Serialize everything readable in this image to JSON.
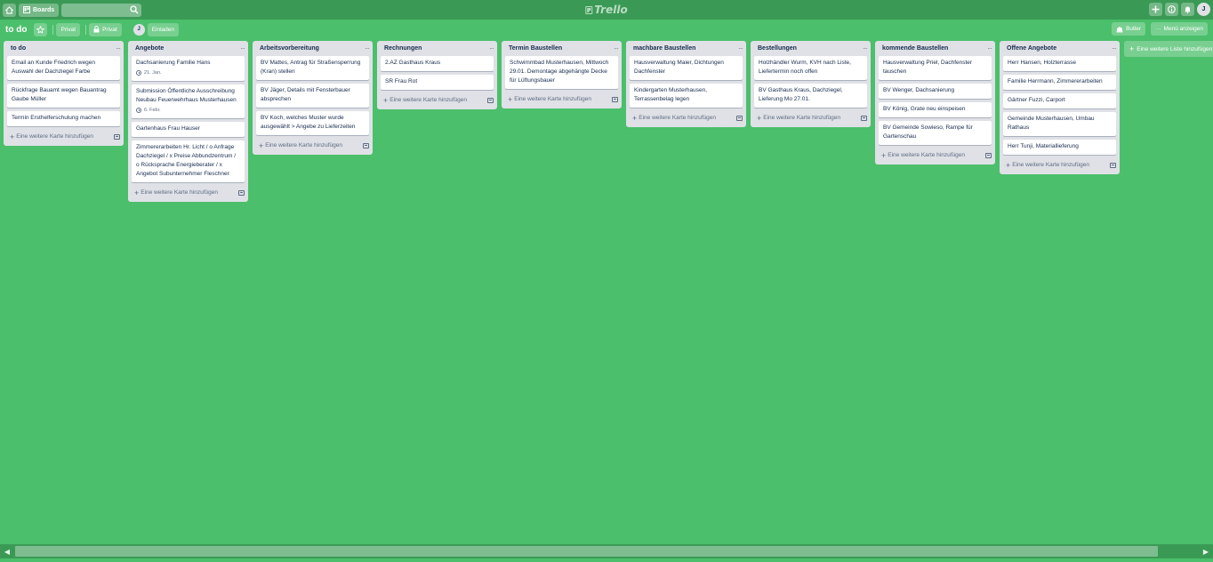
{
  "header": {
    "boards_label": "Boards",
    "search_placeholder": "",
    "logo_text": "Trello",
    "avatar_initial": "J"
  },
  "board": {
    "title": "to do",
    "visibility_team": "Privat",
    "visibility_private": "Privat",
    "member_initial": "J",
    "invite_label": "Einladen",
    "butler_label": "Butler",
    "menu_label": "Menü anzeigen"
  },
  "lists": [
    {
      "title": "to do",
      "cards": [
        {
          "text": "Email an Kunde Friedrich wegen Auswahl der Dachziegel Farbe"
        },
        {
          "text": "Rückfrage Bauamt wegen Bauantrag Gaube Müller"
        },
        {
          "text": "Termin Ersthelferschulung machen"
        }
      ]
    },
    {
      "title": "Angebote",
      "cards": [
        {
          "text": "Dachsanierung Familie Hans",
          "due": "21. Jan."
        },
        {
          "text": "Submission Öffentliche Ausschreibung Neubau Feuerwehrhaus Musterhausen",
          "due": "6. Febr."
        },
        {
          "text": "Gartenhaus Frau Hauser"
        },
        {
          "text": "Zimmererarbeiten Hr. Licht / o Anfrage Dachziegel / x Preise Abbundzentrum / o Rücksprache Energieberater / x Angebot Subunternehmer Fleschner"
        }
      ]
    },
    {
      "title": "Arbeitsvorbereitung",
      "cards": [
        {
          "text": "BV Mattes, Antrag für Straßensperrung (Kran) stellen"
        },
        {
          "text": "BV Jäger, Details mit Fensterbauer absprechen"
        },
        {
          "text": "BV Koch, welches Muster wurde ausgewählt > Angebe zu Lieferzeiten"
        }
      ]
    },
    {
      "title": "Rechnungen",
      "cards": [
        {
          "text": "2.AZ Gasthaus Kraus"
        },
        {
          "text": "SR Frau Rot"
        }
      ]
    },
    {
      "title": "Termin Baustellen",
      "cards": [
        {
          "text": "Schwimmbad Musterhausen, Mittwoch 29.01. Demontage abgehängte Decke für Lüftungsbauer"
        }
      ]
    },
    {
      "title": "machbare Baustellen",
      "cards": [
        {
          "text": "Hausverwaltung Maier, Dichtungen Dachfenster"
        },
        {
          "text": "Kindergarten Musterhausen, Terrassenbelag legen"
        }
      ]
    },
    {
      "title": "Bestellungen",
      "cards": [
        {
          "text": "Holzhändler Wurm, KVH nach Liste, Liefertermin noch offen"
        },
        {
          "text": "BV Gasthaus Kraus, Dachziegel, Lieferung Mo 27.01."
        }
      ]
    },
    {
      "title": "kommende Baustellen",
      "cards": [
        {
          "text": "Hausverwaltung Priel, Dachfenster tauschen"
        },
        {
          "text": "BV Wenger, Dachsanierung"
        },
        {
          "text": "BV König, Grate neu einspeisen"
        },
        {
          "text": "BV Gemeinde Sowieso, Rampe für Gartenschau"
        }
      ]
    },
    {
      "title": "Offene Angebote",
      "cards": [
        {
          "text": "Herr Hansen, Holzterrasse"
        },
        {
          "text": "Familie Herrmann, Zimmererarbeiten"
        },
        {
          "text": "Gärtner Fuzzi, Carport"
        },
        {
          "text": "Gemeinde Musterhausen, Umbau Rathaus"
        },
        {
          "text": "Herr Tunji, Materiallieferung"
        }
      ]
    }
  ],
  "add_card_label": "Eine weitere Karte hinzufügen",
  "add_list_label": "Eine weitere Liste hinzufügen"
}
